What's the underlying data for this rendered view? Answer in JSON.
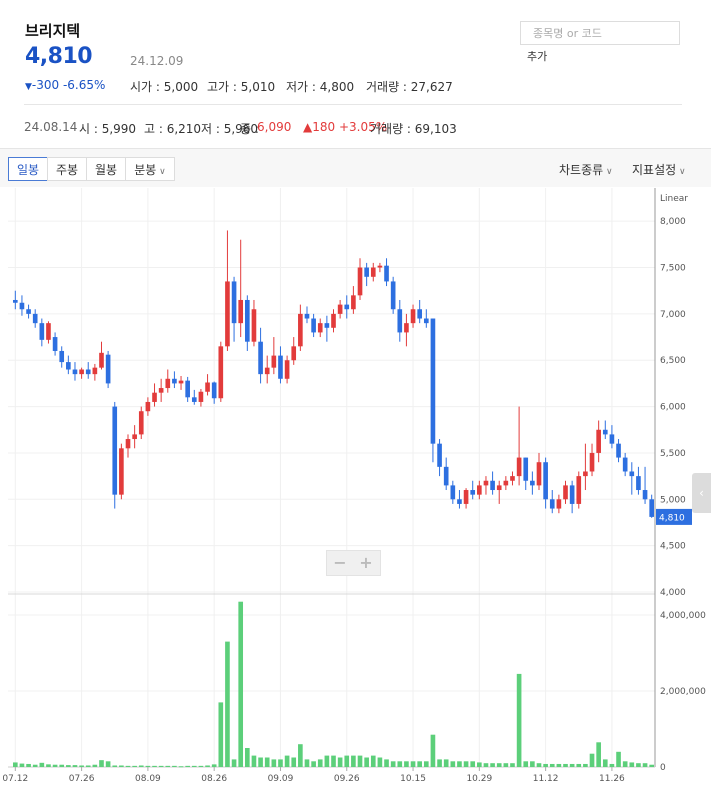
{
  "header": {
    "name": "브리지텍",
    "price": "4,810",
    "date": "24.12.09",
    "change": "-300 -6.65%",
    "open_label": "시가 : 5,000",
    "high_label": "고가 : 5,010",
    "low_label": "저가 : 4,800",
    "volume_label": "거래량 : 27,627"
  },
  "search": {
    "placeholder": "종목명 or 코드",
    "add_label": "추가"
  },
  "history": {
    "date": "24.08.14",
    "open": "시 : 5,990",
    "high": "고 : 6,210",
    "low": "저 : 5,960",
    "close_label": "종 :",
    "close_value": "6,090",
    "change": "▲180 +3.05%",
    "volume": "거래량 : 69,103"
  },
  "toolbar": {
    "tabs": [
      "일봉",
      "주봉",
      "월봉",
      "분봉"
    ],
    "active_tab": "일봉",
    "chart_type": "차트종류",
    "indicator": "지표설정"
  },
  "colors": {
    "up": "#e23b3b",
    "down": "#2d6fe0",
    "volume": "#5ccf7a",
    "price": "#1a52c4"
  },
  "chart_data": {
    "type": "candlestick",
    "scale_label": "Linear",
    "price_ticks": [
      "8,000",
      "7,500",
      "7,000",
      "6,500",
      "6,000",
      "5,500",
      "5,000",
      "4,500",
      "4,000"
    ],
    "price_tick_values": [
      8000,
      7500,
      7000,
      6500,
      6000,
      5500,
      5000,
      4500,
      4000
    ],
    "ylim": [
      4000,
      8250
    ],
    "current_price_label": "4,810",
    "volume_ticks": [
      "4,000,000",
      "2,000,000",
      "0"
    ],
    "volume_tick_values": [
      4000000,
      2000000,
      0
    ],
    "volume_ylim": [
      0,
      4500000
    ],
    "x_labels": [
      "07.12",
      "07.26",
      "08.09",
      "08.26",
      "09.09",
      "09.26",
      "10.15",
      "10.29",
      "11.12",
      "11.26"
    ],
    "x_label_index": [
      0,
      10,
      20,
      30,
      40,
      50,
      60,
      70,
      80,
      90
    ],
    "candles": [
      [
        7150,
        7250,
        7050,
        7120
      ],
      [
        7120,
        7200,
        6980,
        7050
      ],
      [
        7050,
        7100,
        6950,
        7000
      ],
      [
        7000,
        7050,
        6850,
        6900
      ],
      [
        6900,
        6950,
        6650,
        6720
      ],
      [
        6720,
        6920,
        6680,
        6900
      ],
      [
        6750,
        6800,
        6550,
        6600
      ],
      [
        6600,
        6650,
        6420,
        6480
      ],
      [
        6480,
        6550,
        6350,
        6400
      ],
      [
        6400,
        6480,
        6280,
        6350
      ],
      [
        6350,
        6420,
        6300,
        6400
      ],
      [
        6400,
        6480,
        6300,
        6350
      ],
      [
        6350,
        6460,
        6280,
        6420
      ],
      [
        6420,
        6700,
        6400,
        6580
      ],
      [
        6560,
        6600,
        6200,
        6250
      ],
      [
        6000,
        6050,
        4900,
        5050
      ],
      [
        5050,
        5600,
        5000,
        5550
      ],
      [
        5550,
        5700,
        5450,
        5650
      ],
      [
        5650,
        5800,
        5550,
        5700
      ],
      [
        5700,
        6000,
        5650,
        5950
      ],
      [
        5950,
        6100,
        5900,
        6050
      ],
      [
        6050,
        6250,
        6000,
        6150
      ],
      [
        6150,
        6300,
        6050,
        6200
      ],
      [
        6200,
        6400,
        6150,
        6300
      ],
      [
        6300,
        6380,
        6200,
        6250
      ],
      [
        6250,
        6330,
        6180,
        6280
      ],
      [
        6280,
        6320,
        6050,
        6100
      ],
      [
        6100,
        6180,
        6020,
        6050
      ],
      [
        6050,
        6190,
        6000,
        6160
      ],
      [
        6160,
        6350,
        6120,
        6260
      ],
      [
        6260,
        6270,
        6030,
        6090
      ],
      [
        6090,
        6700,
        6050,
        6650
      ],
      [
        6650,
        7900,
        6600,
        7350
      ],
      [
        7350,
        7400,
        6700,
        6900
      ],
      [
        6900,
        7800,
        6750,
        7150
      ],
      [
        7150,
        7200,
        6600,
        6700
      ],
      [
        6700,
        7150,
        6650,
        7050
      ],
      [
        6700,
        6850,
        6250,
        6350
      ],
      [
        6350,
        6550,
        6250,
        6420
      ],
      [
        6420,
        6750,
        6350,
        6550
      ],
      [
        6550,
        6650,
        6250,
        6300
      ],
      [
        6300,
        6550,
        6250,
        6500
      ],
      [
        6500,
        6750,
        6450,
        6650
      ],
      [
        6650,
        7100,
        6600,
        7000
      ],
      [
        7000,
        7080,
        6900,
        6950
      ],
      [
        6950,
        7000,
        6750,
        6800
      ],
      [
        6800,
        6950,
        6750,
        6900
      ],
      [
        6900,
        6980,
        6700,
        6850
      ],
      [
        6850,
        7050,
        6800,
        7000
      ],
      [
        7000,
        7150,
        6950,
        7100
      ],
      [
        7100,
        7200,
        6950,
        7050
      ],
      [
        7050,
        7300,
        7000,
        7200
      ],
      [
        7200,
        7600,
        7150,
        7500
      ],
      [
        7500,
        7550,
        7300,
        7400
      ],
      [
        7400,
        7550,
        7350,
        7500
      ],
      [
        7500,
        7550,
        7450,
        7520
      ],
      [
        7520,
        7600,
        7300,
        7350
      ],
      [
        7350,
        7400,
        7000,
        7050
      ],
      [
        7050,
        7150,
        6700,
        6800
      ],
      [
        6800,
        7000,
        6650,
        6900
      ],
      [
        6900,
        7100,
        6850,
        7050
      ],
      [
        7050,
        7150,
        6900,
        6950
      ],
      [
        6950,
        7050,
        6850,
        6900
      ],
      [
        6950,
        6950,
        5400,
        5600
      ],
      [
        5600,
        5650,
        5250,
        5350
      ],
      [
        5350,
        5450,
        5100,
        5150
      ],
      [
        5150,
        5200,
        4950,
        5000
      ],
      [
        5000,
        5100,
        4900,
        4950
      ],
      [
        4950,
        5120,
        4900,
        5100
      ],
      [
        5100,
        5200,
        5000,
        5050
      ],
      [
        5050,
        5200,
        5000,
        5150
      ],
      [
        5150,
        5250,
        5050,
        5200
      ],
      [
        5200,
        5300,
        5050,
        5100
      ],
      [
        5100,
        5200,
        4950,
        5150
      ],
      [
        5150,
        5250,
        5100,
        5200
      ],
      [
        5200,
        5300,
        5150,
        5250
      ],
      [
        5250,
        6000,
        5150,
        5450
      ],
      [
        5450,
        5450,
        5100,
        5200
      ],
      [
        5200,
        5300,
        5050,
        5150
      ],
      [
        5150,
        5500,
        5100,
        5400
      ],
      [
        5400,
        5450,
        4900,
        5000
      ],
      [
        5000,
        5100,
        4850,
        4900
      ],
      [
        4900,
        5050,
        4850,
        5000
      ],
      [
        5000,
        5200,
        4950,
        5150
      ],
      [
        5150,
        5200,
        4850,
        4950
      ],
      [
        4950,
        5300,
        4900,
        5250
      ],
      [
        5250,
        5600,
        5100,
        5300
      ],
      [
        5300,
        5600,
        5250,
        5500
      ],
      [
        5500,
        5850,
        5400,
        5750
      ],
      [
        5750,
        5850,
        5650,
        5700
      ],
      [
        5700,
        5800,
        5550,
        5600
      ],
      [
        5600,
        5650,
        5400,
        5450
      ],
      [
        5450,
        5500,
        5250,
        5300
      ],
      [
        5300,
        5400,
        5050,
        5250
      ],
      [
        5250,
        5350,
        5050,
        5100
      ],
      [
        5100,
        5350,
        4950,
        5000
      ],
      [
        5000,
        5050,
        4800,
        4810
      ]
    ],
    "volumes": [
      120000,
      90000,
      80000,
      60000,
      110000,
      70000,
      60000,
      60000,
      50000,
      50000,
      40000,
      40000,
      60000,
      180000,
      150000,
      40000,
      40000,
      30000,
      30000,
      40000,
      30000,
      30000,
      30000,
      30000,
      30000,
      20000,
      30000,
      30000,
      30000,
      40000,
      69103,
      1700000,
      3300000,
      200000,
      4350000,
      500000,
      300000,
      250000,
      250000,
      200000,
      200000,
      300000,
      250000,
      600000,
      200000,
      150000,
      200000,
      300000,
      300000,
      250000,
      300000,
      300000,
      300000,
      250000,
      300000,
      250000,
      200000,
      150000,
      150000,
      150000,
      150000,
      150000,
      150000,
      850000,
      200000,
      200000,
      150000,
      150000,
      150000,
      150000,
      120000,
      100000,
      100000,
      100000,
      100000,
      100000,
      2450000,
      150000,
      150000,
      100000,
      80000,
      80000,
      80000,
      80000,
      80000,
      80000,
      80000,
      350000,
      650000,
      200000,
      80000,
      400000,
      150000,
      120000,
      100000,
      100000,
      60000
    ]
  }
}
